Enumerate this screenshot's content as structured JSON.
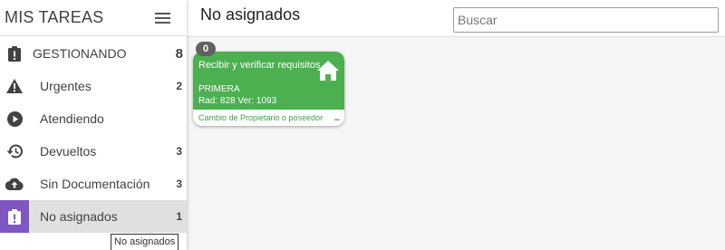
{
  "sidebar": {
    "title": "MIS TAREAS",
    "group": {
      "label": "GESTIONANDO",
      "count": "8"
    },
    "items": [
      {
        "label": "Urgentes",
        "count": "2",
        "icon": "warning-icon"
      },
      {
        "label": "Atendiendo",
        "count": "",
        "icon": "play-circle-icon"
      },
      {
        "label": "Devueltos",
        "count": "3",
        "icon": "history-icon"
      },
      {
        "label": "Sin Documentación",
        "count": "3",
        "icon": "cloud-upload-icon"
      },
      {
        "label": "No asignados",
        "count": "1",
        "icon": "assignment-late-icon"
      }
    ],
    "active_index": 4
  },
  "tooltip": {
    "text": "No asignados"
  },
  "main": {
    "title": "No asignados",
    "search": {
      "placeholder": "Buscar",
      "value": ""
    }
  },
  "cards": [
    {
      "badge": "0",
      "title": "Recibir y verificar requisitos",
      "subtitle": "PRIMERA",
      "rad": "Rad: 828 Ver: 1093",
      "footer": "Cambio de Propietario o poseedor",
      "more": "...",
      "icon": "home-icon"
    }
  ],
  "colors": {
    "card_green": "#4caf50",
    "active_purple": "#7e57c2",
    "badge_gray": "#616161"
  }
}
